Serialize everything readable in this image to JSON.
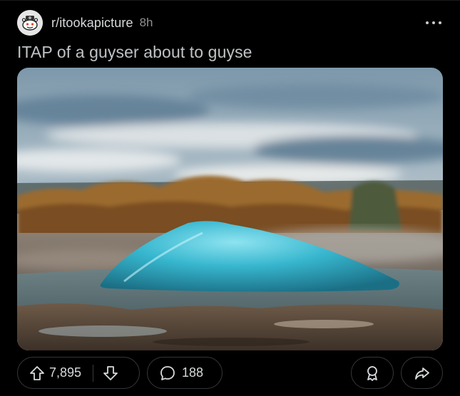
{
  "post": {
    "subreddit": "r/itookapicture",
    "age": "8h",
    "title": "ITAP of a guyser about to guyse"
  },
  "actions": {
    "score": "7,895",
    "comments": "188"
  },
  "icons": {
    "avatar": "subreddit-avatar-icon",
    "more": "more-options-icon",
    "upvote": "upvote-arrow-icon",
    "downvote": "downvote-arrow-icon",
    "comment": "comment-bubble-icon",
    "award": "award-icon",
    "share": "share-arrow-icon"
  },
  "colors": {
    "background": "#000000",
    "text": "#d7dadc",
    "muted": "#8e9192",
    "pill_border": "#343536"
  }
}
